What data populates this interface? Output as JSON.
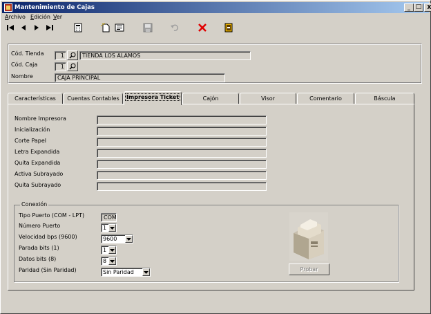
{
  "window": {
    "title": "Mantenimiento de Cajas"
  },
  "titlebar_buttons": {
    "minimize": "_",
    "maximize": "□",
    "close": "X"
  },
  "menu": [
    {
      "label": "Archivo",
      "accel": "A",
      "rest": "rchivo"
    },
    {
      "label": "Edición",
      "accel": "E",
      "rest": "dición"
    },
    {
      "label": "Ver",
      "accel": "V",
      "rest": "er"
    }
  ],
  "toolbar": {
    "icons": [
      "first-record-icon",
      "previous-record-icon",
      "next-record-icon",
      "last-record-icon",
      "calculator-icon",
      "new-record-icon",
      "edit-record-icon",
      "save-icon",
      "undo-icon",
      "delete-icon",
      "exit-icon"
    ]
  },
  "header": {
    "tienda_label": "Cód. Tienda",
    "tienda_code": "1",
    "tienda_name": "TIENDA LOS ALAMOS",
    "caja_label": "Cód. Caja",
    "caja_code": "1",
    "nombre_label": "Nombre",
    "nombre_value": "CAJA PRINCIPAL"
  },
  "tabs": [
    {
      "label": "Características"
    },
    {
      "label": "Cuentas Contables"
    },
    {
      "label": "Impresora Ticket",
      "active": true
    },
    {
      "label": "Cajón"
    },
    {
      "label": "Visor"
    },
    {
      "label": "Comentario"
    },
    {
      "label": "Báscula"
    }
  ],
  "printer": {
    "fields": [
      {
        "label": "Nombre Impresora",
        "value": ""
      },
      {
        "label": "Inicialización",
        "value": ""
      },
      {
        "label": "Corte Papel",
        "value": ""
      },
      {
        "label": "Letra Expandida",
        "value": ""
      },
      {
        "label": "Quita Expandida",
        "value": ""
      },
      {
        "label": "Activa Subrayado",
        "value": ""
      },
      {
        "label": "Quita Subrayado",
        "value": ""
      }
    ]
  },
  "conexion": {
    "legend": "Conexión",
    "tipo_puerto_label": "Tipo Puerto (COM - LPT)",
    "tipo_puerto_value": "COM",
    "numero_puerto_label": "Número Puerto",
    "numero_puerto_value": "1",
    "velocidad_label": "Velocidad bps (9600)",
    "velocidad_value": "9600",
    "parada_label": "Parada bits (1)",
    "parada_value": "1",
    "datos_label": "Datos bits (8)",
    "datos_value": "8",
    "paridad_label": "Paridad (Sin Paridad)",
    "paridad_value": "Sin Paridad",
    "probar_label": "Probar",
    "printer_image_icon": "ticket-printer-image"
  }
}
